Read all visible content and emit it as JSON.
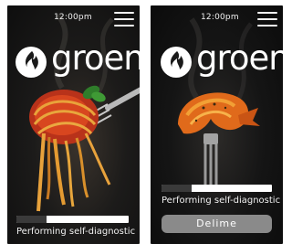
{
  "screens": [
    {
      "id": "left",
      "status": {
        "time": "12:00pm"
      },
      "brand": {
        "name": "groen"
      },
      "progress": {
        "fraction": 0.27
      },
      "status_message": "Performing self-diagnostic"
    },
    {
      "id": "right",
      "status": {
        "time": "12:00pm"
      },
      "brand": {
        "name": "groen"
      },
      "progress": {
        "fraction": 0.27
      },
      "status_message": "Performing self-diagnostic",
      "action_button": {
        "label": "Delime"
      }
    }
  ],
  "colors": {
    "progress_track": "#ffffff",
    "progress_fill": "#3a3a3a",
    "button_bg": "#8a8a8a",
    "text": "#ffffff"
  },
  "icons": {
    "menu": "hamburger-menu-icon",
    "logo": "groen-flame-logo-icon"
  }
}
